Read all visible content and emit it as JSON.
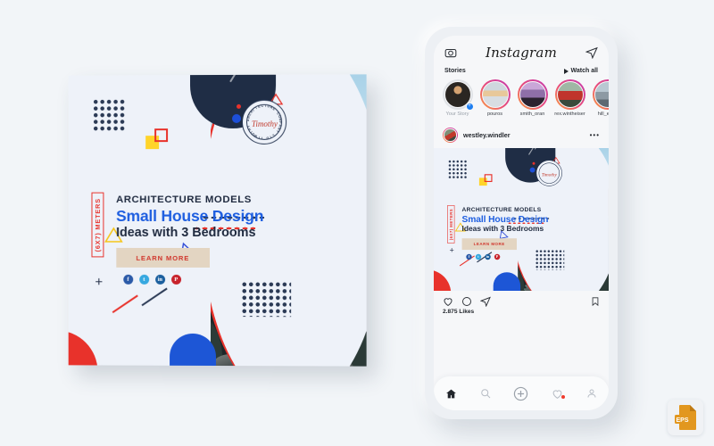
{
  "canvas": {
    "background": "#f2f5f8"
  },
  "poster": {
    "eyebrow": "ARCHITECTURE MODELS",
    "headline": "Small House Design",
    "subheadline": "Ideas with 3 Bedrooms",
    "size_label": "(6X7) METERS",
    "cta_label": "LEARN MORE",
    "stamp": {
      "ring_text": "TIMOTHY ARCHITECTURE COMPANY LTD",
      "signature": "Timothy"
    },
    "socials": [
      {
        "name": "facebook-icon",
        "glyph": "f"
      },
      {
        "name": "twitter-icon",
        "glyph": "t"
      },
      {
        "name": "linkedin-icon",
        "glyph": "in"
      },
      {
        "name": "pinterest-icon",
        "glyph": "P"
      }
    ],
    "colors": {
      "accent_red": "#e8322b",
      "headline_blue": "#1f5fe0",
      "navy": "#1f2a3f",
      "yellow": "#ffd42a",
      "blue": "#1d56d6",
      "cta_bg": "#e3d5c2",
      "panel_bg": "#eef2f9"
    }
  },
  "phone": {
    "app_name": "Instagram",
    "header": {
      "camera_icon": "camera-icon",
      "share_icon": "send-icon"
    },
    "stories_section": {
      "label": "Stories",
      "watch_all": "Watch all"
    },
    "stories": [
      {
        "name": "Your Story",
        "own": true
      },
      {
        "name": "pouros",
        "own": false
      },
      {
        "name": "smith_oran",
        "own": false
      },
      {
        "name": "rex.wintheiser",
        "own": false
      },
      {
        "name": "hill_eliza",
        "own": false
      }
    ],
    "post": {
      "username": "westley.windler",
      "menu_icon": "more-options-icon",
      "likes": "2.875 Likes",
      "actions": [
        "like-icon",
        "comment-icon",
        "share-icon",
        "bookmark-icon"
      ]
    },
    "tabbar": [
      {
        "name": "home-icon",
        "active": true,
        "badge": false
      },
      {
        "name": "search-icon",
        "active": false,
        "badge": false
      },
      {
        "name": "add-post-icon",
        "active": false,
        "badge": false
      },
      {
        "name": "activity-icon",
        "active": false,
        "badge": true
      },
      {
        "name": "profile-icon",
        "active": false,
        "badge": false
      }
    ]
  },
  "badge": {
    "label": "EPS",
    "color": "#e2971f"
  }
}
